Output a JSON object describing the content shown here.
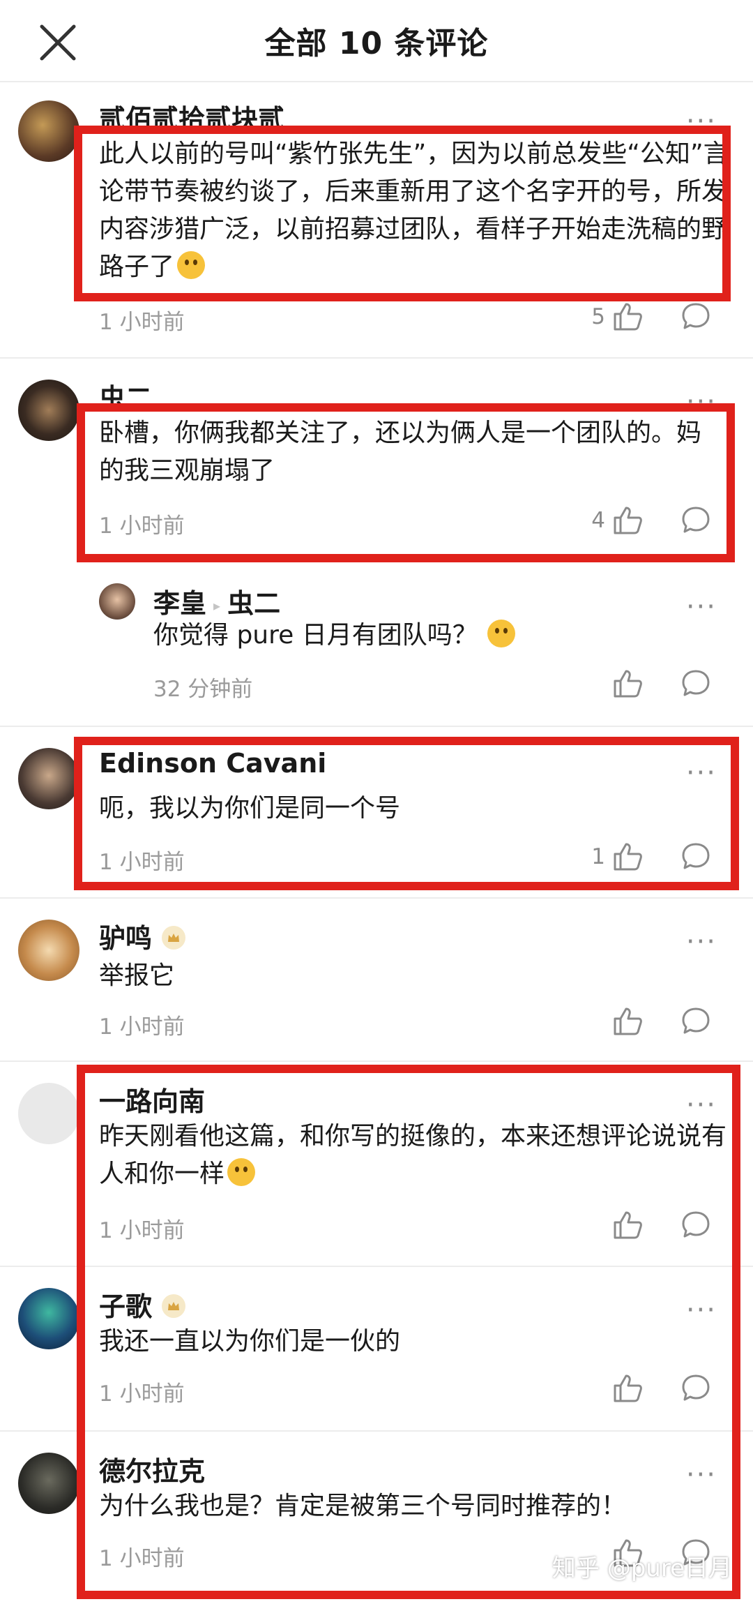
{
  "header": {
    "title": "全部 10 条评论"
  },
  "comments": [
    {
      "author": "贰佰贰拾贰块贰",
      "text": "此人以前的号叫“紫竹张先生”，因为以前总发些“公知”言论带节奏被约谈了，后来重新用了这个名字开的号，所发内容涉猎广泛，以前招募过团队，看样子开始走洗稿的野路子了",
      "time": "1 小时前",
      "likes": "5"
    },
    {
      "author": "虫二",
      "text": "卧槽，你俩我都关注了，还以为俩人是一个团队的。妈的我三观崩塌了",
      "time": "1 小时前",
      "likes": "4"
    },
    {
      "author": "李皇",
      "reply_to": "虫二",
      "text": "你觉得 pure 日月有团队吗？",
      "time": "32 分钟前",
      "likes": ""
    },
    {
      "author": "Edinson Cavani",
      "text": "呃，我以为你们是同一个号",
      "time": "1 小时前",
      "likes": "1"
    },
    {
      "author": "驴鸣",
      "text": "举报它",
      "time": "1 小时前",
      "likes": ""
    },
    {
      "author": "一路向南",
      "text": "昨天刚看他这篇，和你写的挺像的，本来还想评论说说有人和你一样",
      "time": "1 小时前",
      "likes": ""
    },
    {
      "author": "子歌",
      "text": "我还一直以为你们是一伙的",
      "time": "1 小时前",
      "likes": ""
    },
    {
      "author": "德尔拉克",
      "text": "为什么我也是？肯定是被第三个号同时推荐的！",
      "time": "1 小时前",
      "likes": ""
    }
  ],
  "more_label": "···",
  "watermark": "知乎 @pure日月",
  "colors": {
    "highlight": "#e0211b",
    "text": "#1a1a1a",
    "muted": "#9a9a9a"
  },
  "icons": [
    "close-icon",
    "like-icon",
    "reply-icon",
    "more-icon",
    "crown-badge-icon",
    "thinking-emoji",
    "laughing-emoji"
  ]
}
